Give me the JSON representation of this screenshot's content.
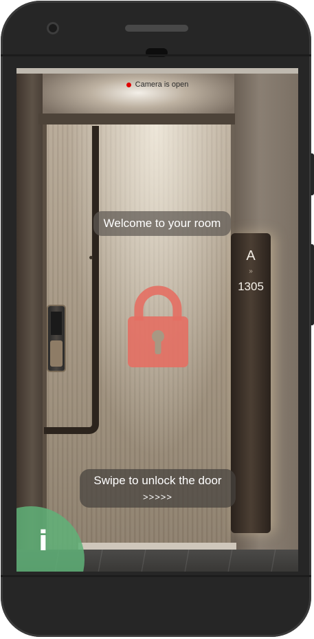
{
  "camera": {
    "status_text": "Camera is open",
    "indicator_color": "#e00000"
  },
  "room": {
    "wing": "A",
    "arrow": "»",
    "number": "1305"
  },
  "welcome": {
    "message": "Welcome to your room"
  },
  "lock": {
    "icon": "lock-icon",
    "state": "locked",
    "color": "#e46f63"
  },
  "unlock": {
    "instruction": "Swipe to unlock the door",
    "arrows": ">>>>>"
  },
  "info_button": {
    "glyph": "i",
    "icon": "info-icon",
    "color": "#5fb178"
  }
}
